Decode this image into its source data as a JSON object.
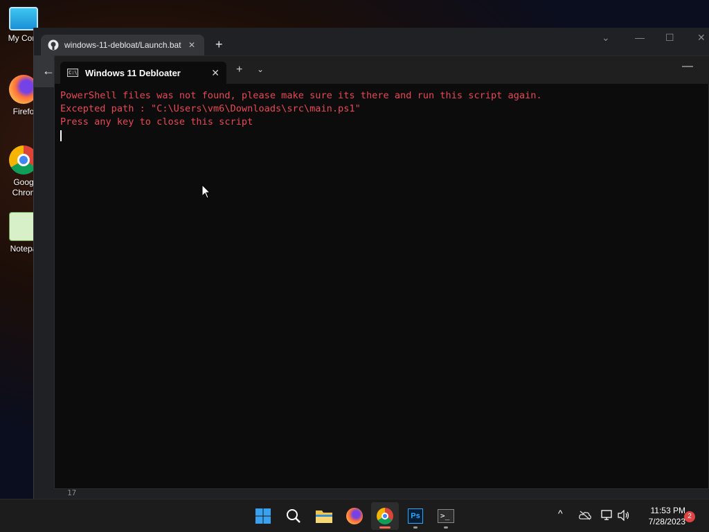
{
  "desktop": {
    "icons": [
      {
        "label": "My Com"
      },
      {
        "label": "Firefo"
      },
      {
        "label": "Goog Chron"
      },
      {
        "label": "Notepa"
      }
    ]
  },
  "chrome": {
    "tab_label": "windows-11-debloat/Launch.bat",
    "bottom_line_number": "17"
  },
  "terminal": {
    "tab_title": "Windows 11 Debloater",
    "lines": [
      "PowerShell files was not found, please make sure its there and run this script again.",
      "Excepted path : \"C:\\Users\\vm6\\Downloads\\src\\main.ps1\"",
      "Press any key to close this script"
    ],
    "text_color": "#e74856"
  },
  "taskbar": {
    "time": "11:53 PM",
    "date": "7/28/2023",
    "notification_count": "2",
    "apps": [
      "start-icon",
      "search-icon",
      "file-explorer-icon",
      "firefox-icon",
      "chrome-icon",
      "photoshop-icon",
      "terminal-icon"
    ],
    "photoshop_label": "Ps"
  }
}
